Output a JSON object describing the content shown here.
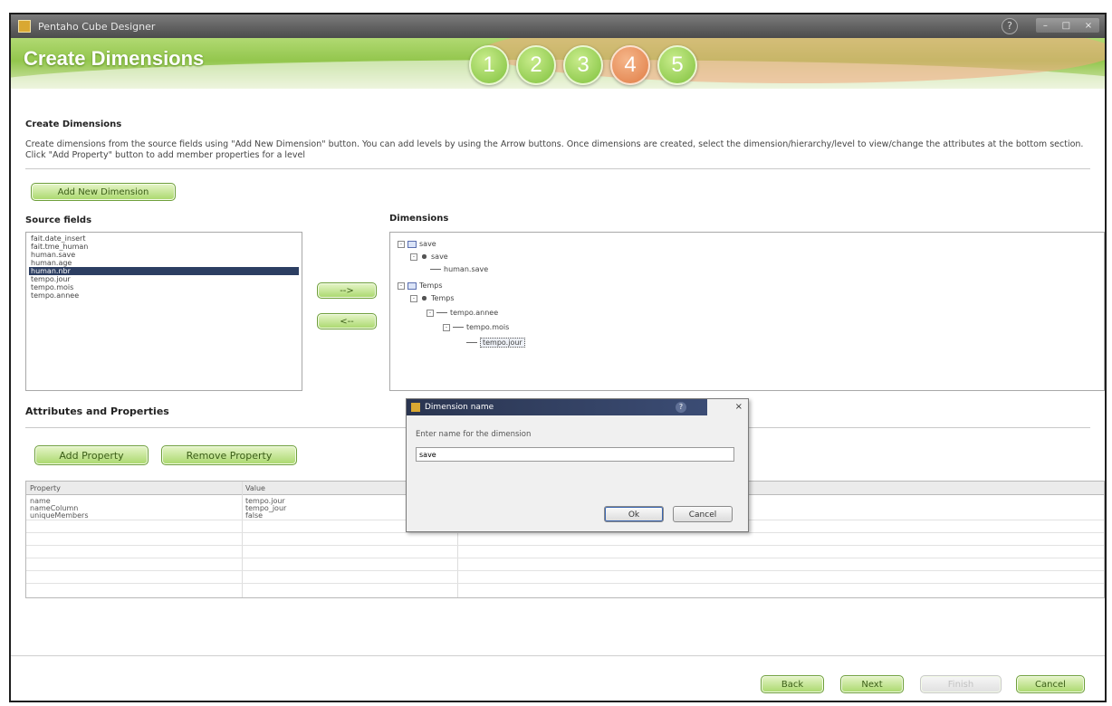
{
  "window": {
    "title": "Pentaho Cube Designer",
    "win_buttons": [
      "–",
      "□",
      "×"
    ]
  },
  "banner": {
    "heading": "Create Dimensions",
    "steps": [
      "1",
      "2",
      "3",
      "4",
      "5"
    ],
    "active_step": "4"
  },
  "section": {
    "title": "Create Dimensions",
    "description": "Create dimensions from the source fields using \"Add New Dimension\" button. You can add levels by using the Arrow buttons. Once dimensions are created, select the dimension/hierarchy/level to view/change the attributes at the bottom section. Click \"Add Property\" button to add member properties for a level"
  },
  "add_dimension_label": "Add New Dimension",
  "source": {
    "label": "Source fields",
    "items": [
      "fait.date_insert",
      "fait.tme_human",
      "human.save",
      "human.age",
      "human.nbr",
      "tempo.jour",
      "tempo.mois",
      "tempo.annee"
    ],
    "selected_index": 4
  },
  "arrows": {
    "add": "-->",
    "remove": "<--"
  },
  "dimensions": {
    "label": "Dimensions",
    "tree": {
      "d1": "save",
      "h1": "save",
      "l1": "human.save",
      "d2": "Temps",
      "h2": "Temps",
      "l2": "tempo.annee",
      "l3": "tempo.mois",
      "l4": "tempo.jour"
    }
  },
  "attributes": {
    "title": "Attributes and Properties",
    "add_property": "Add Property",
    "remove_property": "Remove Property",
    "headers": [
      "Property",
      "Value"
    ],
    "rows": [
      {
        "property": "name",
        "value": "tempo.jour"
      },
      {
        "property": "nameColumn",
        "value": "tempo_jour"
      },
      {
        "property": "uniqueMembers",
        "value": "false"
      }
    ]
  },
  "dialog": {
    "title": "Dimension name",
    "help": "?",
    "close": "×",
    "prompt": "Enter name for the dimension",
    "value": "save",
    "ok": "Ok",
    "cancel": "Cancel"
  },
  "footer": {
    "back": "Back",
    "next": "Next",
    "finish": "Finish",
    "cancel": "Cancel"
  }
}
